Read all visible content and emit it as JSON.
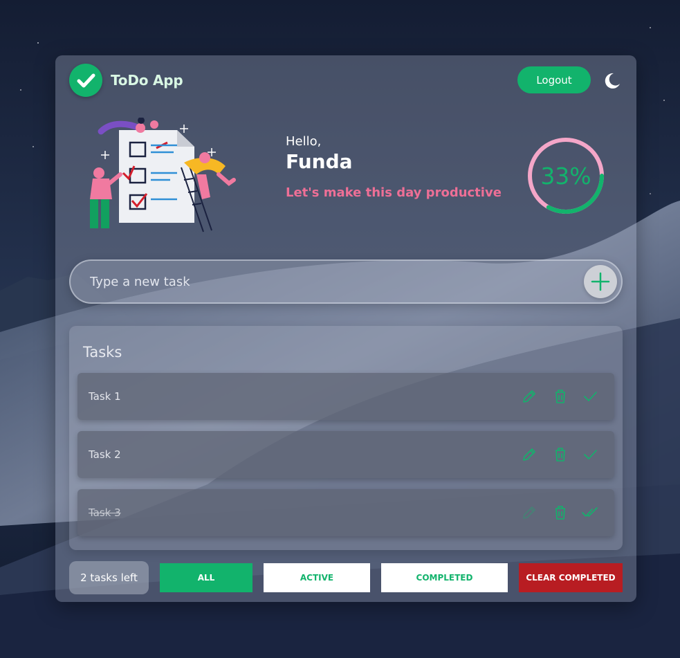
{
  "app": {
    "title": "ToDo App"
  },
  "header": {
    "logout_label": "Logout"
  },
  "greeting": {
    "hello": "Hello,",
    "name": "Funda",
    "motto": "Let's make this day productive"
  },
  "progress": {
    "label": "33%",
    "fraction": 0.33
  },
  "new_task": {
    "placeholder": "Type a new task"
  },
  "tasks_panel": {
    "title": "Tasks",
    "items": [
      {
        "label": "Task 1",
        "completed": false
      },
      {
        "label": "Task 2",
        "completed": false
      },
      {
        "label": "Task 3",
        "completed": true
      }
    ]
  },
  "footer": {
    "tasks_left": "2 tasks left",
    "filters": {
      "all": "ALL",
      "active": "ACTIVE",
      "completed": "COMPLETED"
    },
    "clear_completed": "CLEAR COMPLETED"
  },
  "colors": {
    "accent": "#12b36c",
    "motto": "#ee6f96",
    "danger": "#b81d22",
    "progress_track": "#f4a6c8"
  },
  "icons": [
    "check-logo-icon",
    "moon-icon",
    "todo-illustration",
    "plus-icon",
    "pencil-icon",
    "trash-icon",
    "check-icon",
    "double-check-icon"
  ]
}
